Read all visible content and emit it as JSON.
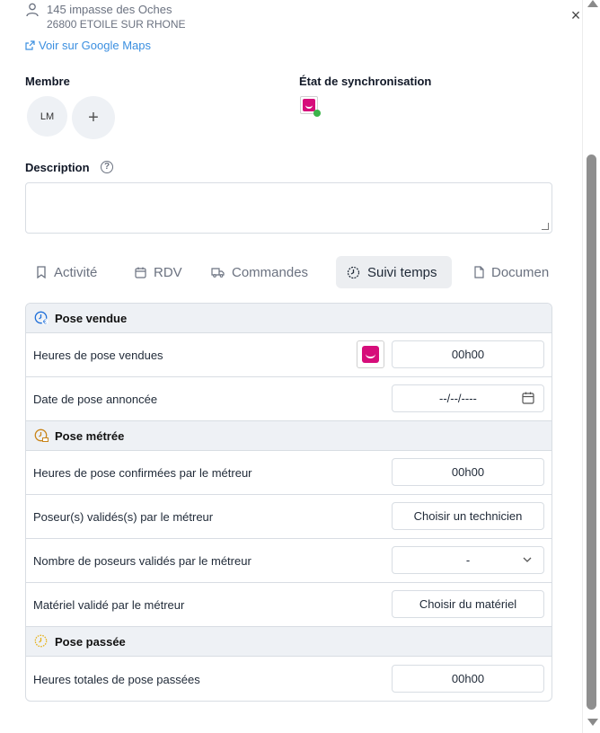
{
  "address": {
    "line1": "145 impasse des Oches",
    "line2": "26800 ETOILE SUR RHONE",
    "maps_link": "Voir sur Google Maps"
  },
  "member": {
    "label": "Membre",
    "avatar_initials": "LM",
    "add_symbol": "+"
  },
  "sync": {
    "label": "État de synchronisation",
    "status_color": "#3cb44b",
    "logo_color": "#d60d7a"
  },
  "description": {
    "label": "Description",
    "help_symbol": "?",
    "value": ""
  },
  "close_symbol": "×",
  "tabs": [
    {
      "label": "Activité",
      "icon": "bookmark-icon",
      "active": false
    },
    {
      "label": "RDV",
      "icon": "calendar-icon",
      "active": false
    },
    {
      "label": "Commandes",
      "icon": "truck-icon",
      "active": false
    },
    {
      "label": "Suivi temps",
      "icon": "clock-icon",
      "active": true
    },
    {
      "label": "Documen",
      "icon": "document-icon",
      "active": false
    }
  ],
  "sections": {
    "pose_vendue": {
      "title": "Pose vendue",
      "icon": "clock-euro-icon",
      "rows": {
        "heures_vendues": {
          "label": "Heures de pose vendues",
          "value": "00h00"
        },
        "date_annoncee": {
          "label": "Date de pose annoncée",
          "value": "--/--/----"
        }
      }
    },
    "pose_metree": {
      "title": "Pose métrée",
      "icon": "clock-ruler-icon",
      "rows": {
        "heures_confirmees": {
          "label": "Heures de pose confirmées par le métreur",
          "value": "00h00"
        },
        "poseurs_valides": {
          "label": "Poseur(s) validés(s) par le métreur",
          "button": "Choisir un technicien"
        },
        "nombre_poseurs": {
          "label": "Nombre de poseurs validés par le métreur",
          "selected": "-"
        },
        "materiel_valide": {
          "label": "Matériel validé par le métreur",
          "button": "Choisir du matériel"
        }
      }
    },
    "pose_passee": {
      "title": "Pose passée",
      "icon": "clock-dashed-icon",
      "rows": {
        "heures_totales": {
          "label": "Heures totales de pose passées",
          "value": "00h00"
        }
      }
    }
  }
}
